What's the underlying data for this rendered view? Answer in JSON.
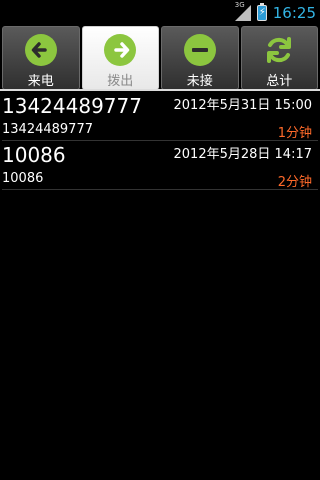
{
  "status_bar": {
    "network": "3G",
    "time": "16:25"
  },
  "tabs": [
    {
      "label": "来电",
      "icon": "arrow-left-icon",
      "selected": false
    },
    {
      "label": "拨出",
      "icon": "arrow-right-icon",
      "selected": true
    },
    {
      "label": "未接",
      "icon": "minus-icon",
      "selected": false
    },
    {
      "label": "总计",
      "icon": "refresh-icon",
      "selected": false
    }
  ],
  "calls": [
    {
      "number": "13424489777",
      "number_sub": "13424489777",
      "datetime": "2012年5月31日 15:00",
      "duration": "1分钟"
    },
    {
      "number": "10086",
      "number_sub": "10086",
      "datetime": "2012年5月28日 14:17",
      "duration": "2分钟"
    }
  ],
  "colors": {
    "accent_green": "#8cc63f",
    "time_blue": "#33b5e5",
    "duration_orange": "#ff6a2a"
  }
}
